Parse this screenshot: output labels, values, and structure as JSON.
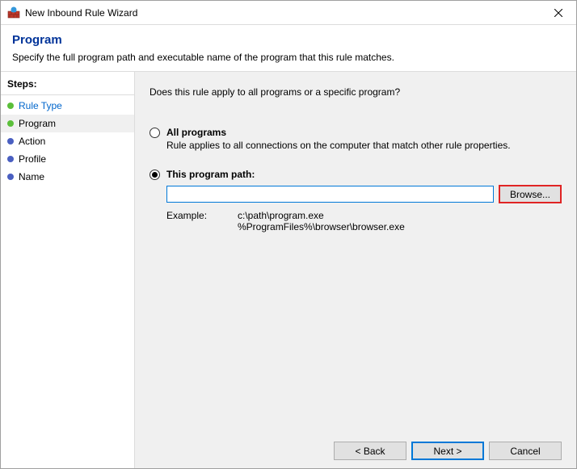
{
  "window": {
    "title": "New Inbound Rule Wizard"
  },
  "header": {
    "title": "Program",
    "subtitle": "Specify the full program path and executable name of the program that this rule matches."
  },
  "sidebar": {
    "heading": "Steps:",
    "items": [
      {
        "label": "Rule Type",
        "state": "completed"
      },
      {
        "label": "Program",
        "state": "current"
      },
      {
        "label": "Action",
        "state": "pending"
      },
      {
        "label": "Profile",
        "state": "pending"
      },
      {
        "label": "Name",
        "state": "pending"
      }
    ]
  },
  "main": {
    "question": "Does this rule apply to all programs or a specific program?",
    "option_all": {
      "title": "All programs",
      "desc": "Rule applies to all connections on the computer that match other rule properties."
    },
    "option_path": {
      "title": "This program path:",
      "value": "",
      "browse_label": "Browse...",
      "example_label": "Example:",
      "example_text": "c:\\path\\program.exe\n%ProgramFiles%\\browser\\browser.exe"
    }
  },
  "footer": {
    "back": "< Back",
    "next": "Next >",
    "cancel": "Cancel"
  }
}
